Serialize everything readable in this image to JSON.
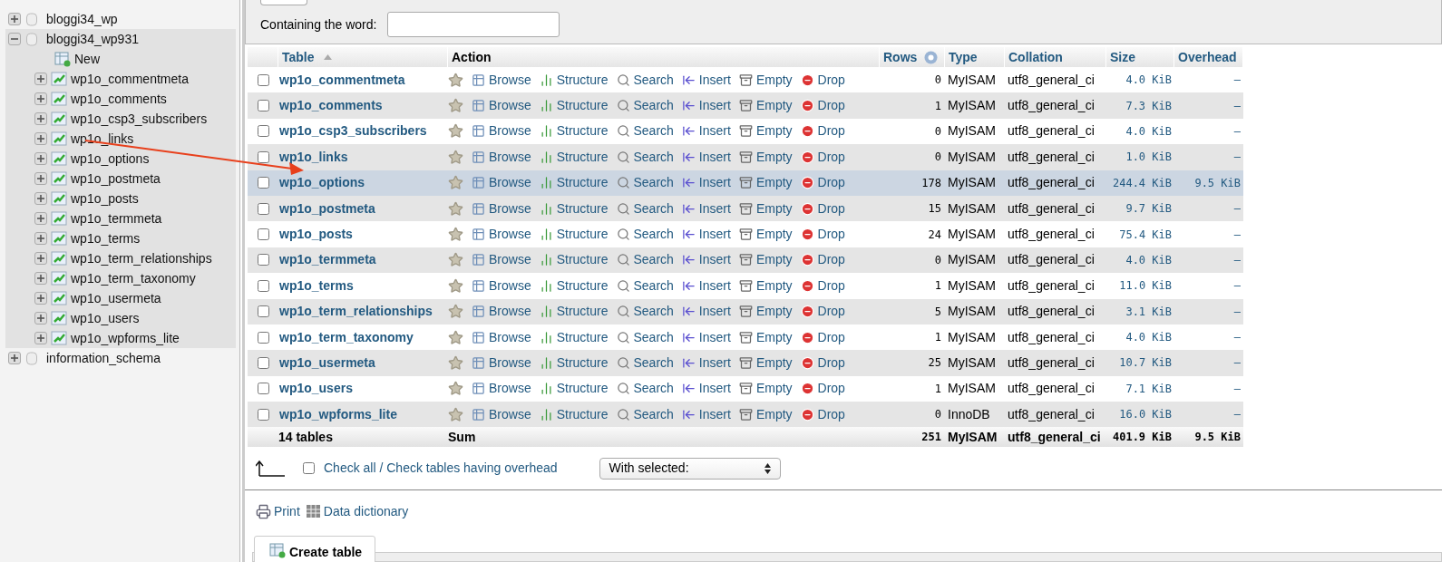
{
  "sidebar": {
    "databases": [
      {
        "name": "bloggi34_wp",
        "expanded": false,
        "selected": false
      },
      {
        "name": "bloggi34_wp931",
        "expanded": true,
        "selected": true,
        "children": [
          {
            "kind": "new",
            "name": "New"
          },
          {
            "kind": "table",
            "name": "wp1o_commentmeta"
          },
          {
            "kind": "table",
            "name": "wp1o_comments"
          },
          {
            "kind": "table",
            "name": "wp1o_csp3_subscribers"
          },
          {
            "kind": "table",
            "name": "wp1o_links"
          },
          {
            "kind": "table",
            "name": "wp1o_options"
          },
          {
            "kind": "table",
            "name": "wp1o_postmeta"
          },
          {
            "kind": "table",
            "name": "wp1o_posts"
          },
          {
            "kind": "table",
            "name": "wp1o_termmeta"
          },
          {
            "kind": "table",
            "name": "wp1o_terms"
          },
          {
            "kind": "table",
            "name": "wp1o_term_relationships"
          },
          {
            "kind": "table",
            "name": "wp1o_term_taxonomy"
          },
          {
            "kind": "table",
            "name": "wp1o_usermeta"
          },
          {
            "kind": "table",
            "name": "wp1o_users"
          },
          {
            "kind": "table",
            "name": "wp1o_wpforms_lite"
          }
        ]
      },
      {
        "name": "information_schema",
        "expanded": false,
        "selected": false
      }
    ]
  },
  "filter": {
    "label": "Containing the word:"
  },
  "table": {
    "columns": [
      "Table",
      "Action",
      "Rows",
      "Type",
      "Collation",
      "Size",
      "Overhead"
    ],
    "rows": [
      {
        "name": "wp1o_commentmeta",
        "highlighted": false,
        "actions": [
          "Browse",
          "Structure",
          "Search",
          "Insert",
          "Empty",
          "Drop"
        ],
        "rows": "0",
        "type": "MyISAM",
        "collation": "utf8_general_ci",
        "size": "4.0 KiB",
        "overhead": "–"
      },
      {
        "name": "wp1o_comments",
        "highlighted": false,
        "actions": [
          "Browse",
          "Structure",
          "Search",
          "Insert",
          "Empty",
          "Drop"
        ],
        "rows": "1",
        "type": "MyISAM",
        "collation": "utf8_general_ci",
        "size": "7.3 KiB",
        "overhead": "–"
      },
      {
        "name": "wp1o_csp3_subscribers",
        "highlighted": false,
        "actions": [
          "Browse",
          "Structure",
          "Search",
          "Insert",
          "Empty",
          "Drop"
        ],
        "rows": "0",
        "type": "MyISAM",
        "collation": "utf8_general_ci",
        "size": "4.0 KiB",
        "overhead": "–"
      },
      {
        "name": "wp1o_links",
        "highlighted": false,
        "actions": [
          "Browse",
          "Structure",
          "Search",
          "Insert",
          "Empty",
          "Drop"
        ],
        "rows": "0",
        "type": "MyISAM",
        "collation": "utf8_general_ci",
        "size": "1.0 KiB",
        "overhead": "–"
      },
      {
        "name": "wp1o_options",
        "highlighted": true,
        "actions": [
          "Browse",
          "Structure",
          "Search",
          "Insert",
          "Empty",
          "Drop"
        ],
        "rows": "178",
        "type": "MyISAM",
        "collation": "utf8_general_ci",
        "size": "244.4 KiB",
        "overhead": "9.5 KiB"
      },
      {
        "name": "wp1o_postmeta",
        "highlighted": false,
        "actions": [
          "Browse",
          "Structure",
          "Search",
          "Insert",
          "Empty",
          "Drop"
        ],
        "rows": "15",
        "type": "MyISAM",
        "collation": "utf8_general_ci",
        "size": "9.7 KiB",
        "overhead": "–"
      },
      {
        "name": "wp1o_posts",
        "highlighted": false,
        "actions": [
          "Browse",
          "Structure",
          "Search",
          "Insert",
          "Empty",
          "Drop"
        ],
        "rows": "24",
        "type": "MyISAM",
        "collation": "utf8_general_ci",
        "size": "75.4 KiB",
        "overhead": "–"
      },
      {
        "name": "wp1o_termmeta",
        "highlighted": false,
        "actions": [
          "Browse",
          "Structure",
          "Search",
          "Insert",
          "Empty",
          "Drop"
        ],
        "rows": "0",
        "type": "MyISAM",
        "collation": "utf8_general_ci",
        "size": "4.0 KiB",
        "overhead": "–"
      },
      {
        "name": "wp1o_terms",
        "highlighted": false,
        "actions": [
          "Browse",
          "Structure",
          "Search",
          "Insert",
          "Empty",
          "Drop"
        ],
        "rows": "1",
        "type": "MyISAM",
        "collation": "utf8_general_ci",
        "size": "11.0 KiB",
        "overhead": "–"
      },
      {
        "name": "wp1o_term_relationships",
        "highlighted": false,
        "actions": [
          "Browse",
          "Structure",
          "Search",
          "Insert",
          "Empty",
          "Drop"
        ],
        "rows": "5",
        "type": "MyISAM",
        "collation": "utf8_general_ci",
        "size": "3.1 KiB",
        "overhead": "–"
      },
      {
        "name": "wp1o_term_taxonomy",
        "highlighted": false,
        "actions": [
          "Browse",
          "Structure",
          "Search",
          "Insert",
          "Empty",
          "Drop"
        ],
        "rows": "1",
        "type": "MyISAM",
        "collation": "utf8_general_ci",
        "size": "4.0 KiB",
        "overhead": "–"
      },
      {
        "name": "wp1o_usermeta",
        "highlighted": false,
        "actions": [
          "Browse",
          "Structure",
          "Search",
          "Insert",
          "Empty",
          "Drop"
        ],
        "rows": "25",
        "type": "MyISAM",
        "collation": "utf8_general_ci",
        "size": "10.7 KiB",
        "overhead": "–"
      },
      {
        "name": "wp1o_users",
        "highlighted": false,
        "actions": [
          "Browse",
          "Structure",
          "Search",
          "Insert",
          "Empty",
          "Drop"
        ],
        "rows": "1",
        "type": "MyISAM",
        "collation": "utf8_general_ci",
        "size": "7.1 KiB",
        "overhead": "–"
      },
      {
        "name": "wp1o_wpforms_lite",
        "highlighted": false,
        "actions": [
          "Browse",
          "Structure",
          "Search",
          "Insert",
          "Empty",
          "Drop"
        ],
        "rows": "0",
        "type": "InnoDB",
        "collation": "utf8_general_ci",
        "size": "16.0 KiB",
        "overhead": "–"
      }
    ],
    "summary": {
      "tables": "14 tables",
      "label": "Sum",
      "rows": "251",
      "type": "MyISAM",
      "collation": "utf8_general_ci",
      "size": "401.9 KiB",
      "overhead": "9.5 KiB"
    }
  },
  "footer": {
    "check_all_checked": false,
    "check_all": "Check all / Check tables having overhead",
    "with_selected": "With selected:",
    "print": "Print",
    "data_dictionary": "Data dictionary",
    "create_table": "Create table"
  }
}
